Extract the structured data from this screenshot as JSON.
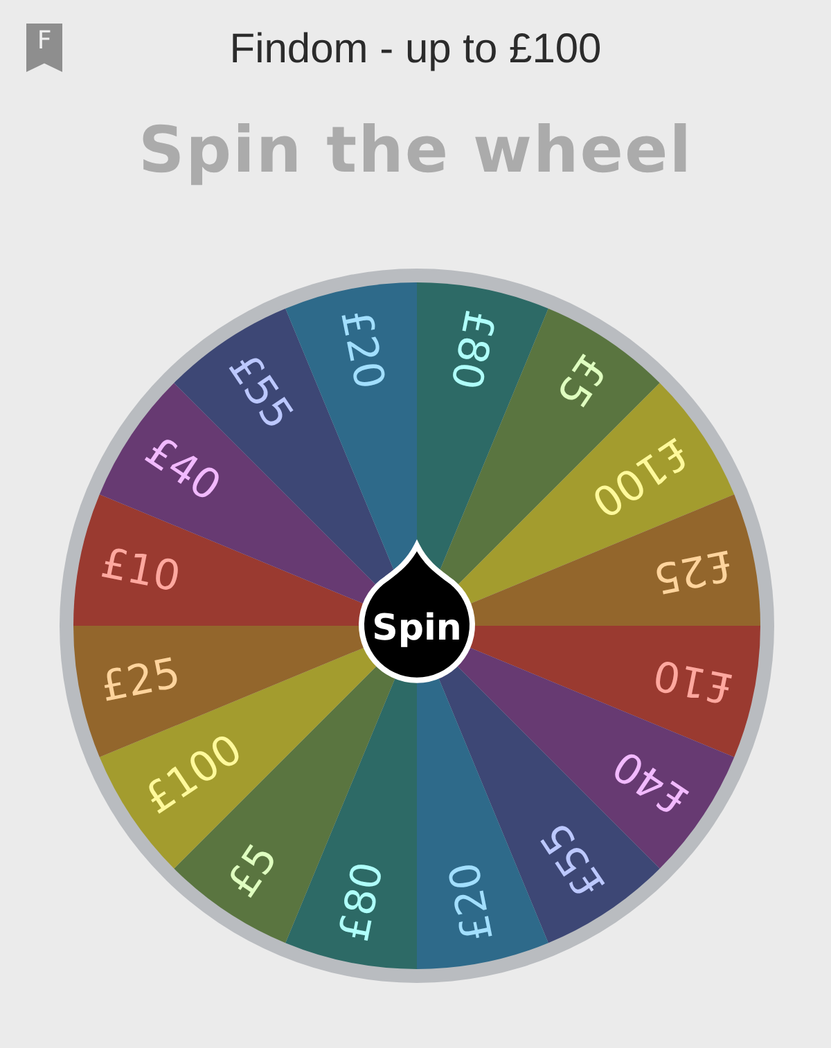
{
  "header": {
    "badge": "F",
    "title": "Findom - up to £100"
  },
  "heading": "Spin the wheel",
  "wheel": {
    "spin_label": "Spin",
    "segments": [
      {
        "label": "£80",
        "color": "#2d6a66"
      },
      {
        "label": "£5",
        "color": "#5a7540"
      },
      {
        "label": "£100",
        "color": "#a39c2e"
      },
      {
        "label": "£25",
        "color": "#93662c"
      },
      {
        "label": "£10",
        "color": "#9a3a30"
      },
      {
        "label": "£40",
        "color": "#673a72"
      },
      {
        "label": "£55",
        "color": "#3d4775"
      },
      {
        "label": "£20",
        "color": "#2e6a8a"
      },
      {
        "label": "£80",
        "color": "#2d6a66"
      },
      {
        "label": "£5",
        "color": "#5a7540"
      },
      {
        "label": "£100",
        "color": "#a39c2e"
      },
      {
        "label": "£25",
        "color": "#93662c"
      },
      {
        "label": "£10",
        "color": "#9a3a30"
      },
      {
        "label": "£40",
        "color": "#673a72"
      },
      {
        "label": "£55",
        "color": "#3d4775"
      },
      {
        "label": "£20",
        "color": "#2e6a8a"
      }
    ]
  }
}
